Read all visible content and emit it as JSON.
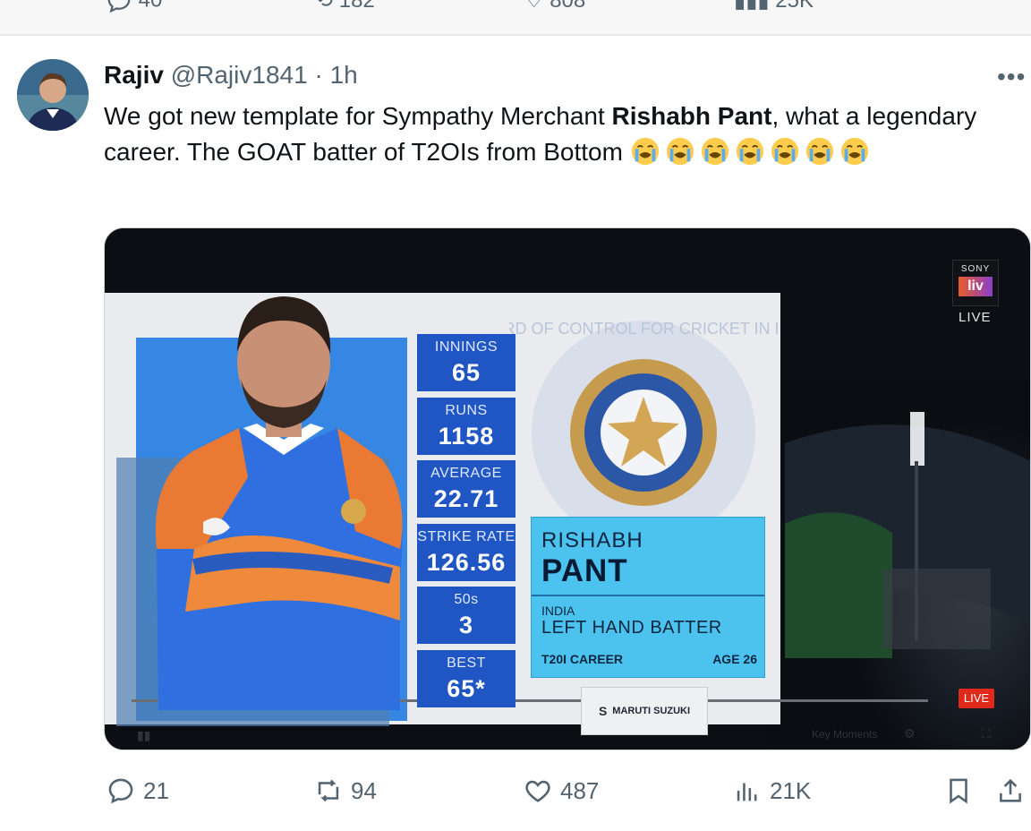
{
  "previous_post_actions": {
    "replies": "40",
    "reposts": "182",
    "likes": "808",
    "views": "25K"
  },
  "post": {
    "author_name": "Rajiv",
    "author_handle": "@Rajiv1841",
    "separator": "·",
    "time": "1h",
    "more_label": "•••",
    "text_part1": "We got new template for Sympathy Merchant ",
    "text_bold": "Rishabh Pant",
    "text_part2": ", what a legendary career. The GOAT batter of T2OIs from Bottom",
    "emoji_icon": "loudly-crying-face-icon",
    "emoji_count": 7
  },
  "media": {
    "broadcaster_top": "SONY",
    "broadcaster_logo": "liv",
    "live_label": "LIVE",
    "live_badge": "LIVE",
    "sponsor": "MARUTI SUZUKI",
    "emblem_text": "BOARD OF CONTROL FOR CRICKET IN INDIA",
    "stats": [
      {
        "label": "INNINGS",
        "value": "65"
      },
      {
        "label": "RUNS",
        "value": "1158"
      },
      {
        "label": "AVERAGE",
        "value": "22.71"
      },
      {
        "label": "STRIKE RATE",
        "value": "126.56"
      },
      {
        "label": "50s",
        "value": "3"
      },
      {
        "label": "BEST",
        "value": "65*"
      }
    ],
    "player": {
      "first_name": "RISHABH",
      "last_name": "PANT",
      "country": "INDIA",
      "role": "LEFT HAND BATTER",
      "format": "T20I CAREER",
      "age": "AGE 26"
    },
    "controls_text": "Key Moments"
  },
  "actions": {
    "replies": "21",
    "reposts": "94",
    "likes": "487",
    "views": "21K"
  },
  "colors": {
    "accent": "#1d9bf0",
    "muted": "#536471",
    "stat_blue": "#1f56c4",
    "name_panel": "#4cc3ee",
    "live_red": "#e0291b"
  }
}
